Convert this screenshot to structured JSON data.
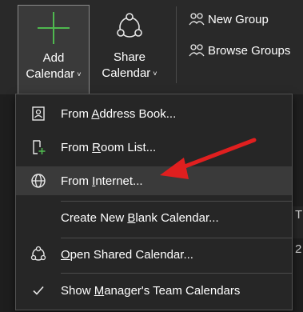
{
  "ribbon": {
    "add_calendar": {
      "line1": "Add",
      "line2": "Calendar",
      "chevron": "˅"
    },
    "share_calendar": {
      "line1": "Share",
      "line2": "Calendar",
      "chevron": "˅"
    },
    "new_group": "New Group",
    "browse_groups": "Browse Groups"
  },
  "menu": {
    "items": [
      {
        "pre": "From ",
        "ul": "A",
        "post": "ddress Book...",
        "icon": "address-book-icon"
      },
      {
        "pre": "From ",
        "ul": "R",
        "post": "oom List...",
        "icon": "room-list-icon"
      },
      {
        "pre": "From ",
        "ul": "I",
        "post": "nternet...",
        "icon": "globe-icon"
      },
      {
        "pre": "Create New ",
        "ul": "B",
        "post": "lank Calendar...",
        "icon": ""
      },
      {
        "pre": "",
        "ul": "O",
        "post": "pen Shared Calendar...",
        "icon": "share-icon"
      },
      {
        "pre": "Show ",
        "ul": "M",
        "post": "anager's Team Calendars",
        "icon": "checkmark-icon"
      }
    ]
  },
  "background": {
    "snippet_1": "T",
    "snippet_2": "2"
  },
  "colors": {
    "accent_green": "#4fb84f",
    "arrow_red": "#e01f1f",
    "menu_bg": "#262626",
    "hover_bg": "#3a3a3a"
  }
}
